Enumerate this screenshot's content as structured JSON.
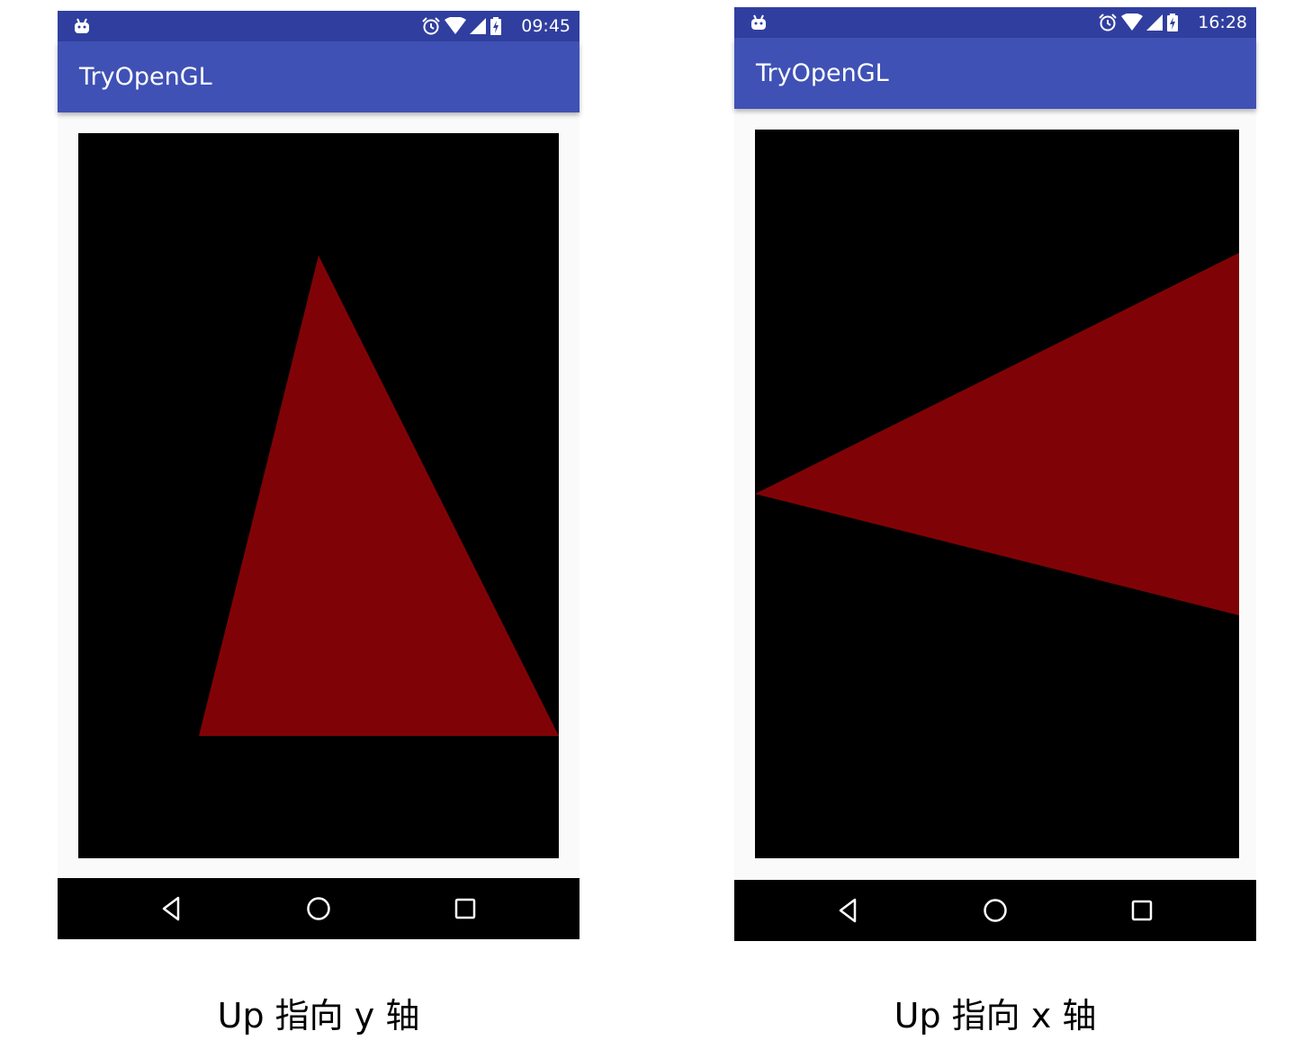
{
  "screens": [
    {
      "status_time": "09:45",
      "app_title": "TryOpenGL",
      "caption": "Up 指向 y 轴",
      "triangle_color": "#7f0306"
    },
    {
      "status_time": "16:28",
      "app_title": "TryOpenGL",
      "caption": "Up 指向 x 轴",
      "triangle_color": "#7f0306"
    }
  ],
  "colors": {
    "status_bar": "#303f9f",
    "app_bar": "#3f51b5",
    "gl_background": "#000000",
    "nav_bar": "#000000"
  },
  "icons": {
    "status": [
      "android-debug-icon",
      "alarm-icon",
      "wifi-icon",
      "cell-signal-icon",
      "battery-charging-icon"
    ],
    "nav": [
      "back-icon",
      "home-icon",
      "recents-icon"
    ]
  }
}
